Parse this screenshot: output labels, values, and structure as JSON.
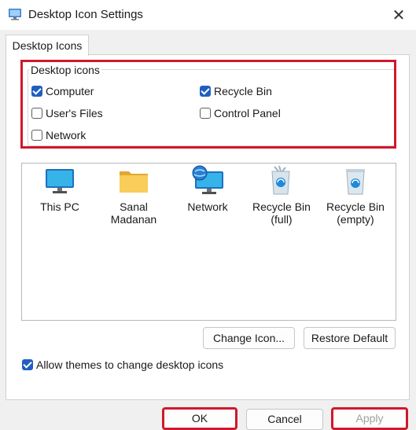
{
  "window": {
    "title": "Desktop Icon Settings",
    "close_glyph": "✕"
  },
  "tab": {
    "label": "Desktop Icons"
  },
  "group": {
    "title": "Desktop icons",
    "checkboxes": [
      {
        "label": "Computer",
        "checked": true
      },
      {
        "label": "Recycle Bin",
        "checked": true
      },
      {
        "label": "User's Files",
        "checked": false
      },
      {
        "label": "Control Panel",
        "checked": false
      },
      {
        "label": "Network",
        "checked": false
      }
    ]
  },
  "icons": [
    {
      "line1": "This PC",
      "line2": "",
      "icon": "monitor-icon"
    },
    {
      "line1": "Sanal",
      "line2": "Madanan",
      "icon": "folder-icon"
    },
    {
      "line1": "Network",
      "line2": "",
      "icon": "network-icon"
    },
    {
      "line1": "Recycle Bin",
      "line2": "(full)",
      "icon": "recycle-bin-full-icon"
    },
    {
      "line1": "Recycle Bin",
      "line2": "(empty)",
      "icon": "recycle-bin-empty-icon"
    }
  ],
  "buttons": {
    "change_icon": "Change Icon...",
    "restore_default": "Restore Default",
    "ok": "OK",
    "cancel": "Cancel",
    "apply": "Apply"
  },
  "allow_themes": {
    "label": "Allow themes to change desktop icons",
    "checked": true
  },
  "colors": {
    "accent": "#1f5fbf",
    "highlight": "#d0182b"
  }
}
